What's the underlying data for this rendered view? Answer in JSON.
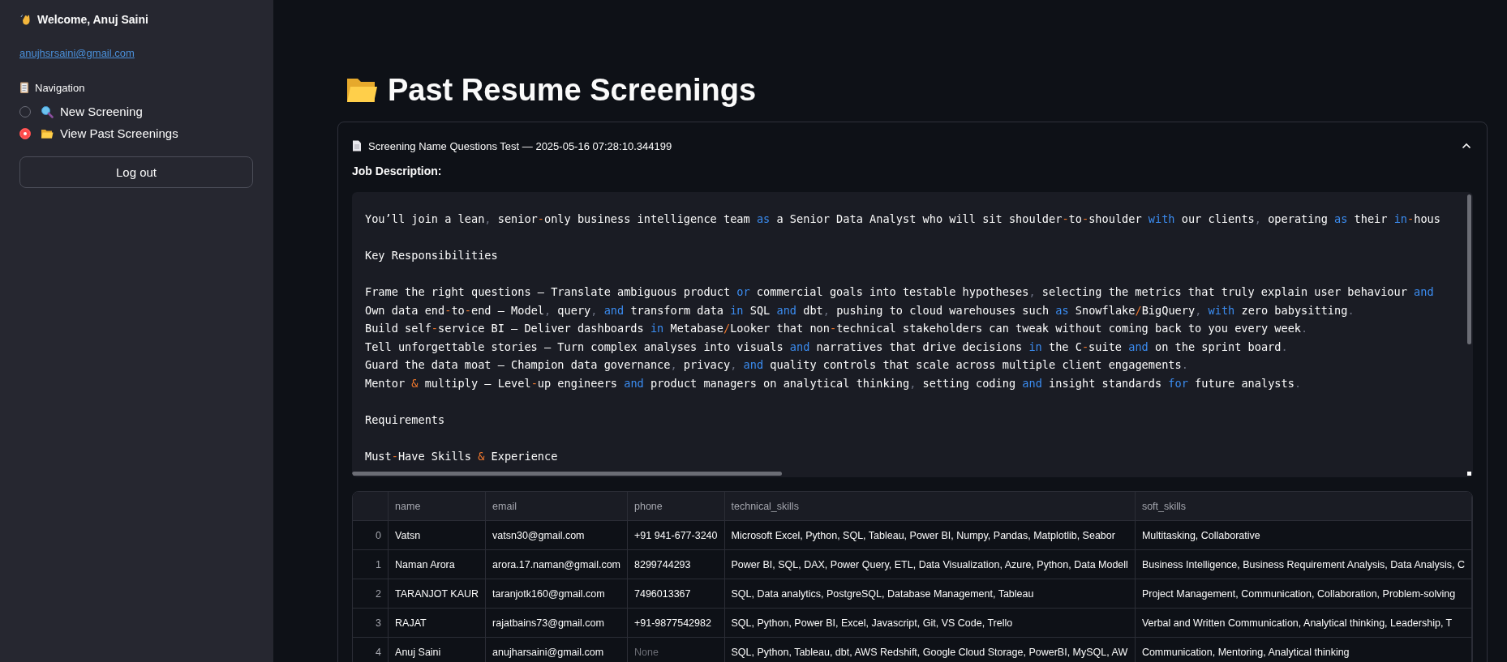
{
  "sidebar": {
    "welcome": "Welcome, Anuj Saini",
    "email_link": "anujhsrsaini@gmail.com",
    "navigation_label": "Navigation",
    "nav_options": [
      {
        "label": "New Screening",
        "selected": false
      },
      {
        "label": "View Past Screenings",
        "selected": true
      }
    ],
    "logout_button": "Log out"
  },
  "page": {
    "title": "Past Resume Screenings"
  },
  "expander": {
    "header": "Screening Name Questions Test — 2025-05-16 07:28:10.344199",
    "expanded": true,
    "section_label": "Job Description:",
    "code_lines": [
      {
        "spaced": false,
        "segments": [
          {
            "kind": "plain",
            "text": "You’ll join a lean, senior-only business intelligence team "
          },
          {
            "kind": "keyword",
            "text": "as"
          },
          {
            "kind": "plain",
            "text": " a Senior Data Analyst who will sit shoulder-to-shoulder "
          },
          {
            "kind": "keyword",
            "text": "with"
          },
          {
            "kind": "plain",
            "text": " our clients, operating "
          },
          {
            "kind": "keyword",
            "text": "as"
          },
          {
            "kind": "plain",
            "text": " their "
          },
          {
            "kind": "keyword",
            "text": "in"
          },
          {
            "kind": "plain",
            "text": "-hous"
          }
        ]
      },
      {
        "spaced": true,
        "segments": [
          {
            "kind": "plain",
            "text": "Key Responsibilities"
          }
        ]
      },
      {
        "spaced": true,
        "segments": [
          {
            "kind": "plain",
            "text": "Frame the right questions – Translate ambiguous product "
          },
          {
            "kind": "keyword",
            "text": "or"
          },
          {
            "kind": "plain",
            "text": " commercial goals into testable hypotheses, selecting the metrics that truly explain user behaviour "
          },
          {
            "kind": "keyword",
            "text": "and"
          }
        ]
      },
      {
        "spaced": false,
        "segments": [
          {
            "kind": "plain",
            "text": "Own data end-to-end – Model, query, "
          },
          {
            "kind": "keyword",
            "text": "and"
          },
          {
            "kind": "plain",
            "text": " transform data "
          },
          {
            "kind": "keyword",
            "text": "in"
          },
          {
            "kind": "plain",
            "text": " SQL "
          },
          {
            "kind": "keyword",
            "text": "and"
          },
          {
            "kind": "plain",
            "text": " dbt, pushing to cloud warehouses such "
          },
          {
            "kind": "keyword",
            "text": "as"
          },
          {
            "kind": "plain",
            "text": " Snowflake/BigQuery, "
          },
          {
            "kind": "keyword",
            "text": "with"
          },
          {
            "kind": "plain",
            "text": " zero babysitting."
          }
        ]
      },
      {
        "spaced": false,
        "segments": [
          {
            "kind": "plain",
            "text": "Build self-service BI – Deliver dashboards "
          },
          {
            "kind": "keyword",
            "text": "in"
          },
          {
            "kind": "plain",
            "text": " Metabase/Looker that non-technical stakeholders can tweak without coming back to you every week."
          }
        ]
      },
      {
        "spaced": false,
        "segments": [
          {
            "kind": "plain",
            "text": "Tell unforgettable stories – Turn complex analyses into visuals "
          },
          {
            "kind": "keyword",
            "text": "and"
          },
          {
            "kind": "plain",
            "text": " narratives that drive decisions "
          },
          {
            "kind": "keyword",
            "text": "in"
          },
          {
            "kind": "plain",
            "text": " the C-suite "
          },
          {
            "kind": "keyword",
            "text": "and"
          },
          {
            "kind": "plain",
            "text": " on the sprint board."
          }
        ]
      },
      {
        "spaced": false,
        "segments": [
          {
            "kind": "plain",
            "text": "Guard the data moat – Champion data governance, privacy, "
          },
          {
            "kind": "keyword",
            "text": "and"
          },
          {
            "kind": "plain",
            "text": " quality controls that scale across multiple client engagements."
          }
        ]
      },
      {
        "spaced": false,
        "segments": [
          {
            "kind": "plain",
            "text": "Mentor & multiply – Level-up engineers "
          },
          {
            "kind": "keyword",
            "text": "and"
          },
          {
            "kind": "plain",
            "text": " product managers on analytical thinking, setting coding "
          },
          {
            "kind": "keyword",
            "text": "and"
          },
          {
            "kind": "plain",
            "text": " insight standards "
          },
          {
            "kind": "keyword",
            "text": "for"
          },
          {
            "kind": "plain",
            "text": " future analysts."
          }
        ]
      },
      {
        "spaced": true,
        "segments": [
          {
            "kind": "plain",
            "text": "Requirements"
          }
        ]
      },
      {
        "spaced": true,
        "segments": [
          {
            "kind": "plain",
            "text": "Must-Have Skills & Experience"
          }
        ]
      }
    ],
    "table": {
      "columns": [
        "name",
        "email",
        "phone",
        "technical_skills",
        "soft_skills"
      ],
      "rows": [
        {
          "index": "0",
          "name": "Vatsn",
          "email": "vatsn30@gmail.com",
          "phone": "+91 941-677-3240",
          "phone_missing": false,
          "technical_skills": "Microsoft Excel, Python, SQL, Tableau, Power BI, Numpy, Pandas, Matplotlib, Seabor",
          "soft_skills": "Multitasking, Collaborative"
        },
        {
          "index": "1",
          "name": "Naman Arora",
          "email": "arora.17.naman@gmail.com",
          "phone": "8299744293",
          "phone_missing": false,
          "technical_skills": "Power BI, SQL, DAX, Power Query, ETL, Data Visualization, Azure, Python, Data Modell",
          "soft_skills": "Business Intelligence, Business Requirement Analysis, Data Analysis, C"
        },
        {
          "index": "2",
          "name": "TARANJOT KAUR",
          "email": "taranjotk160@gmail.com",
          "phone": "7496013367",
          "phone_missing": false,
          "technical_skills": "SQL, Data analytics, PostgreSQL, Database Management, Tableau",
          "soft_skills": "Project Management, Communication, Collaboration, Problem-solving"
        },
        {
          "index": "3",
          "name": "RAJAT",
          "email": "rajatbains73@gmail.com",
          "phone": "+91-9877542982",
          "phone_missing": false,
          "technical_skills": "SQL, Python, Power BI, Excel, Javascript, Git, VS Code, Trello",
          "soft_skills": "Verbal and Written Communication, Analytical thinking, Leadership, T"
        },
        {
          "index": "4",
          "name": "Anuj Saini",
          "email": "anujharsaini@gmail.com",
          "phone": "None",
          "phone_missing": true,
          "technical_skills": "SQL, Python, Tableau, dbt, AWS Redshift, Google Cloud Storage, PowerBI, MySQL, AW",
          "soft_skills": "Communication, Mentoring, Analytical thinking"
        }
      ]
    }
  }
}
